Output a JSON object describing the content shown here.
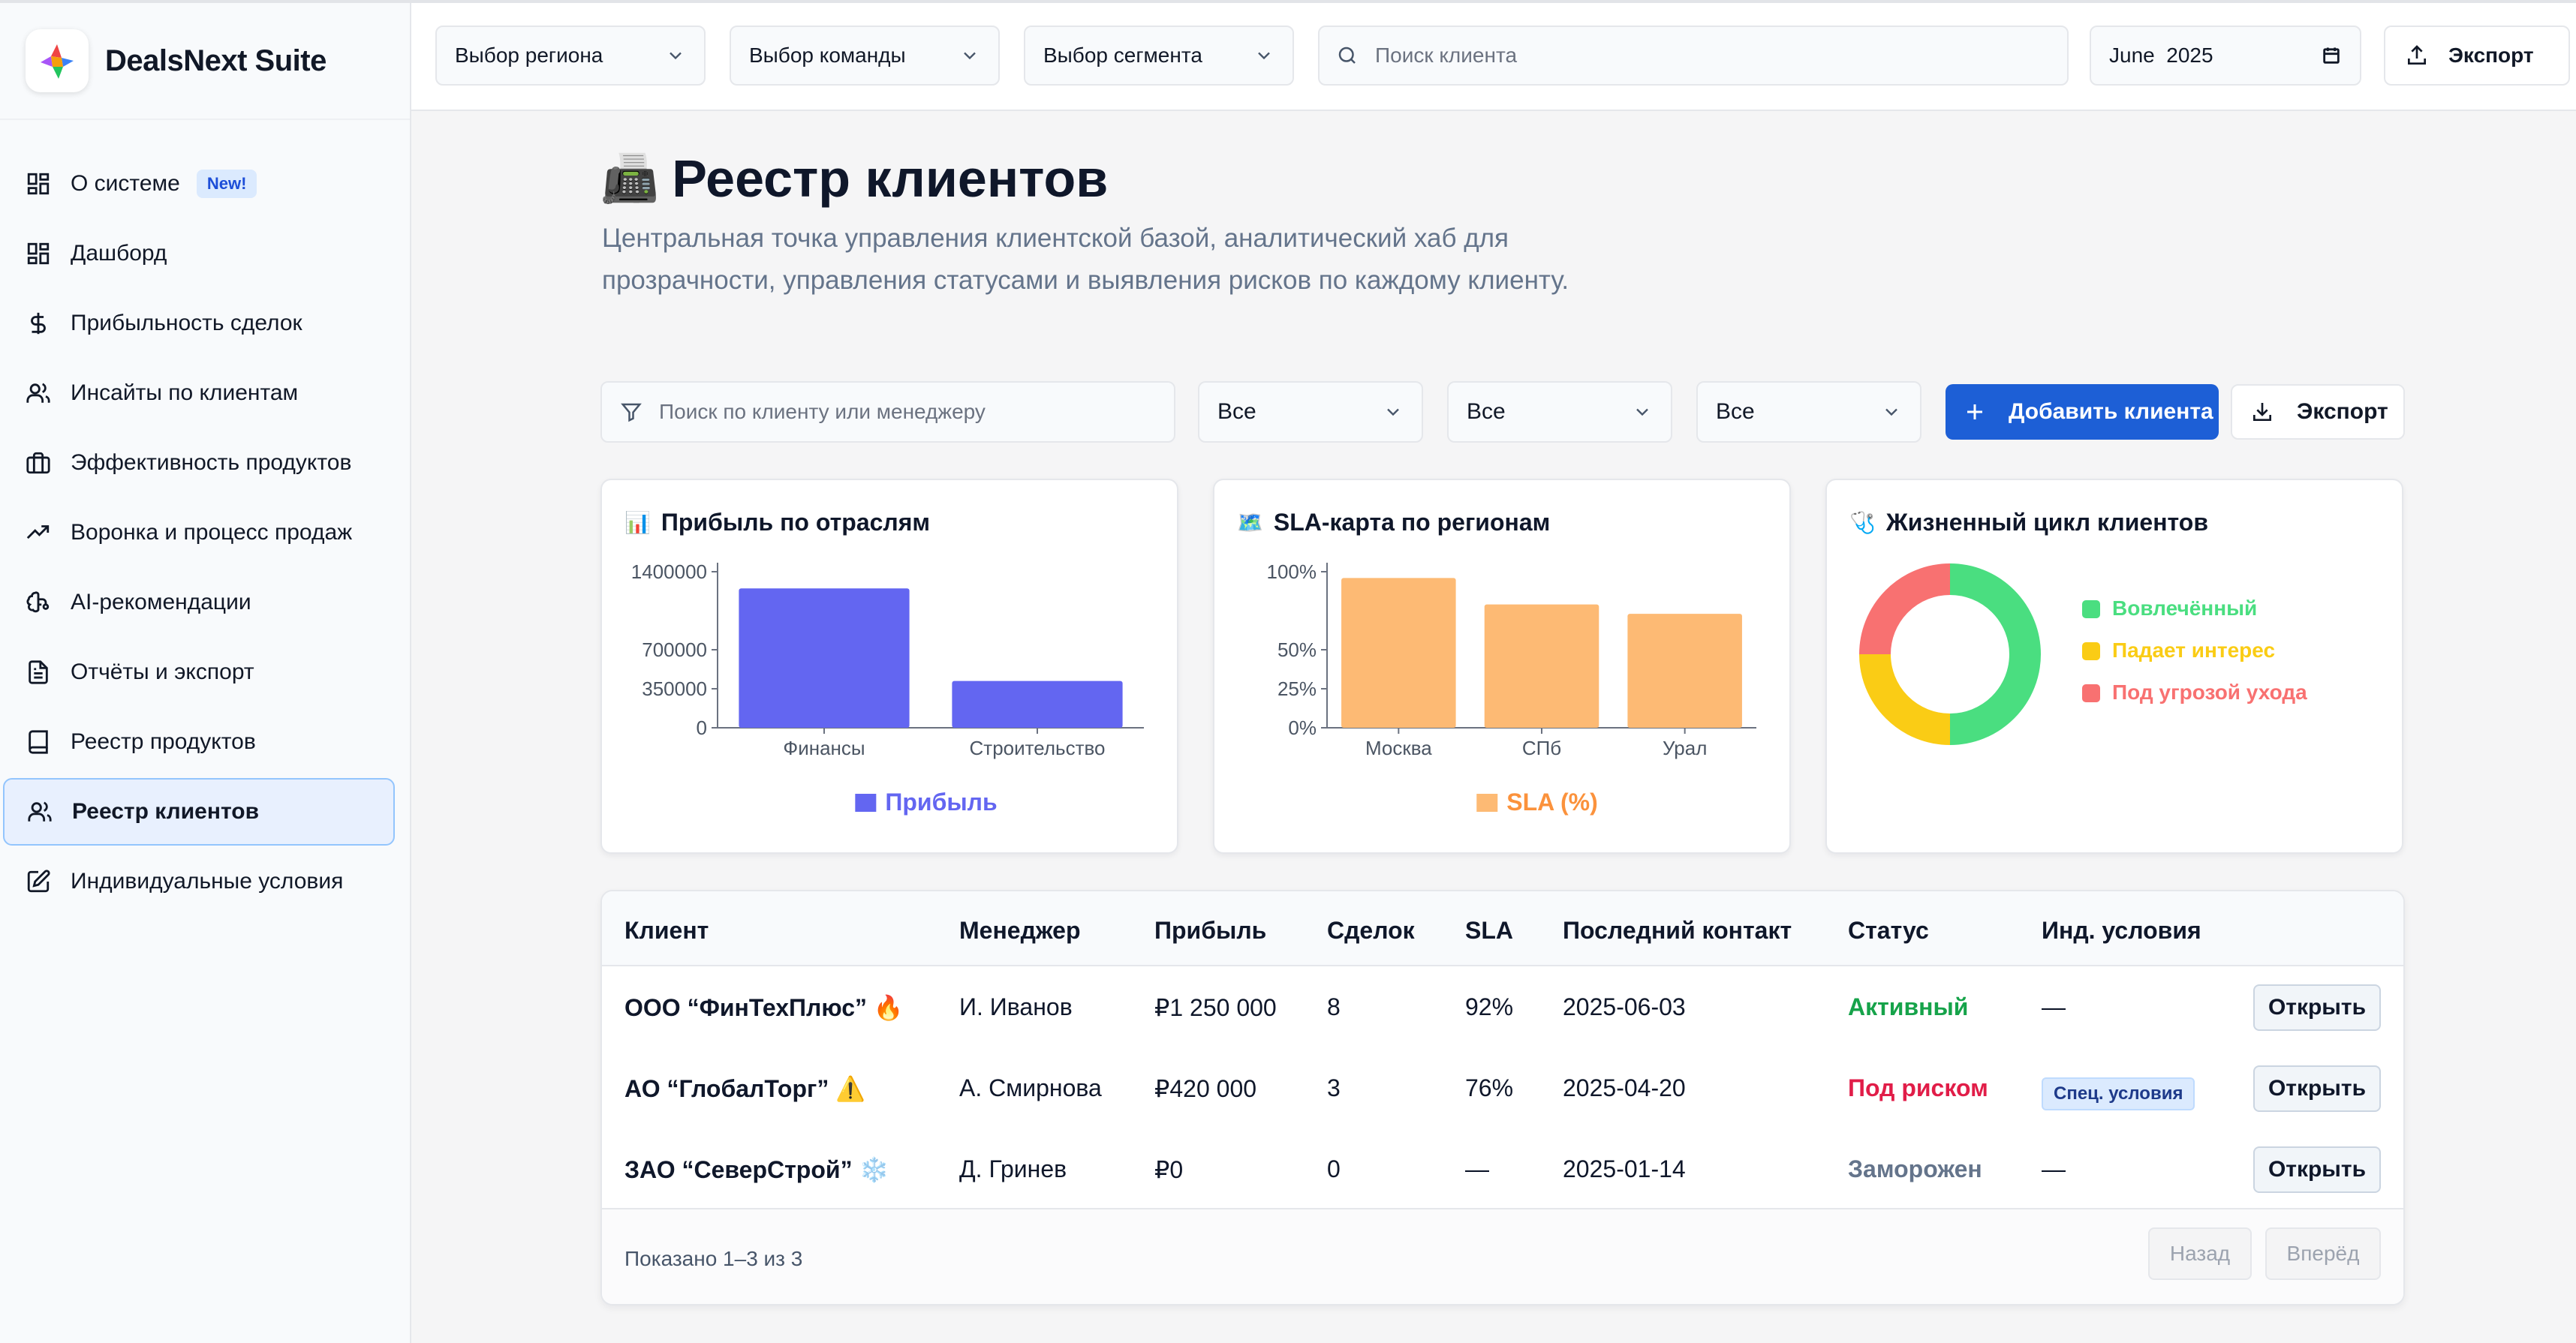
{
  "app": {
    "name": "DealsNext Suite"
  },
  "sidebar": {
    "items": [
      {
        "label": "О системе",
        "icon": "dashboard-grid-icon",
        "badge": "New!"
      },
      {
        "label": "Дашборд",
        "icon": "dashboard-grid-icon"
      },
      {
        "label": "Прибыльность сделок",
        "icon": "dollar-icon"
      },
      {
        "label": "Инсайты по клиентам",
        "icon": "users-icon"
      },
      {
        "label": "Эффективность продуктов",
        "icon": "briefcase-icon"
      },
      {
        "label": "Воронка и процесс продаж",
        "icon": "trending-up-icon"
      },
      {
        "label": "AI-рекомендации",
        "icon": "brain-icon"
      },
      {
        "label": "Отчёты и экспорт",
        "icon": "document-icon"
      },
      {
        "label": "Реестр продуктов",
        "icon": "book-icon"
      },
      {
        "label": "Реестр клиентов",
        "icon": "users-icon",
        "active": true
      },
      {
        "label": "Индивидуальные условия",
        "icon": "edit-icon"
      }
    ]
  },
  "topbar": {
    "region": "Выбор региона",
    "team": "Выбор команды",
    "segment": "Выбор сегмента",
    "search_placeholder": "Поиск клиента",
    "date": "June  2025",
    "export": "Экспорт"
  },
  "page": {
    "emoji": "📠",
    "title": "Реестр клиентов",
    "description": "Центральная точка управления клиентской базой, аналитический хаб для прозрачности, управления статусами и выявления рисков по каждому клиенту."
  },
  "filters": {
    "search_placeholder": "Поиск по клиенту или менеджеру",
    "selects": [
      "Все",
      "Все",
      "Все"
    ],
    "add_client": "Добавить клиента",
    "export": "Экспорт"
  },
  "cards": {
    "profit": {
      "emoji": "📊",
      "title": "Прибыль по отраслям"
    },
    "sla": {
      "emoji": "🗺️",
      "title": "SLA-карта по регионам"
    },
    "lifecycle": {
      "emoji": "🩺",
      "title": "Жизненный цикл клиентов"
    }
  },
  "chart_data": [
    {
      "type": "bar",
      "title": "Прибыль по отраслям",
      "categories": [
        "Финансы",
        "Строительство"
      ],
      "series": [
        {
          "name": "Прибыль",
          "values": [
            1250000,
            420000
          ],
          "color": "#6366f1"
        }
      ],
      "yticks": [
        "0",
        "350000",
        "700000",
        "1400000"
      ],
      "ylim": [
        0,
        1400000
      ]
    },
    {
      "type": "bar",
      "title": "SLA-карта по регионам",
      "categories": [
        "Москва",
        "СПб",
        "Урал"
      ],
      "series": [
        {
          "name": "SLA (%)",
          "values": [
            96,
            79,
            73
          ],
          "color": "#fdba74"
        }
      ],
      "yticks": [
        "0%",
        "25%",
        "50%",
        "100%"
      ],
      "ylim": [
        0,
        100
      ]
    },
    {
      "type": "pie",
      "title": "Жизненный цикл клиентов",
      "labels": [
        "Вовлечённый",
        "Падает интерес",
        "Под угрозой ухода"
      ],
      "values": [
        50,
        25,
        25
      ],
      "colors": [
        "#4ade80",
        "#facc15",
        "#f87171"
      ]
    }
  ],
  "table": {
    "headers": [
      "Клиент",
      "Менеджер",
      "Прибыль",
      "Сделок",
      "SLA",
      "Последний контакт",
      "Статус",
      "Инд. условия"
    ],
    "rows": [
      {
        "client": "ООО “ФинТехПлюс”",
        "emoji": "🔥",
        "manager": "И. Иванов",
        "profit": "₽1 250 000",
        "deals": "8",
        "sla": "92%",
        "last_contact": "2025-06-03",
        "status": "Активный",
        "status_color": "#16a34a",
        "conditions": "—",
        "action": "Открыть"
      },
      {
        "client": "АО “ГлобалТорг”",
        "emoji": "⚠️",
        "manager": "А. Смирнова",
        "profit": "₽420 000",
        "deals": "3",
        "sla": "76%",
        "last_contact": "2025-04-20",
        "status": "Под риском",
        "status_color": "#e11d48",
        "conditions": "Спец. условия",
        "action": "Открыть"
      },
      {
        "client": "ЗАО “СеверСтрой”",
        "emoji": "❄️",
        "manager": "Д. Гринев",
        "profit": "₽0",
        "deals": "0",
        "sla": "—",
        "last_contact": "2025-01-14",
        "status": "Заморожен",
        "status_color": "#64748b",
        "conditions": "—",
        "action": "Открыть"
      }
    ],
    "footer": {
      "info": "Показано 1–3 из 3",
      "prev": "Назад",
      "next": "Вперёд"
    }
  }
}
